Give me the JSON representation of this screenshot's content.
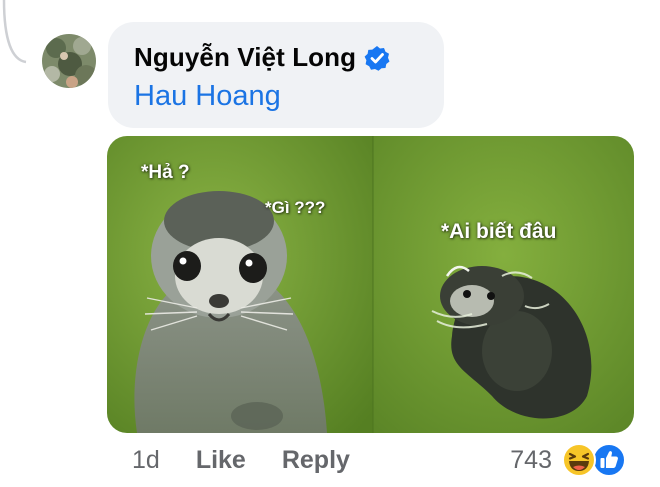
{
  "comment": {
    "author": "Nguyễn Việt Long",
    "verified_icon": "verified-badge-icon",
    "mention": "Hau Hoang"
  },
  "meme": {
    "captions": [
      "*Hả ?",
      "*Gì ???",
      "*Ai biết đâu"
    ]
  },
  "actions": {
    "time": "1d",
    "like_label": "Like",
    "reply_label": "Reply"
  },
  "reactions": {
    "count": "743",
    "icons": [
      "haha-icon",
      "like-icon"
    ]
  },
  "colors": {
    "bubble_bg": "#f0f2f5",
    "mention": "#1b74e4",
    "verified": "#1877f2",
    "meta_text": "#65676b",
    "meme_green": "#6a9a2e"
  }
}
